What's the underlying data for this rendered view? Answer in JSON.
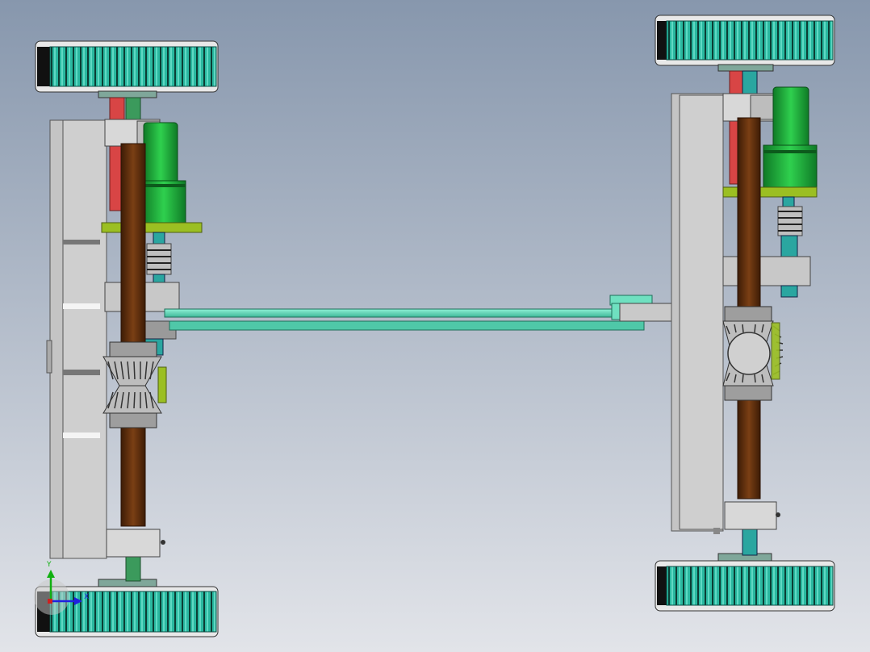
{
  "colors": {
    "background_top": "#8797ad",
    "background_bottom": "#e2e4e9",
    "wheel": "#2ab8a0",
    "wheel_light": "#6fe0cc",
    "wheel_dark": "#0a5a4e",
    "axle": "#5a2d0e",
    "frame_plate": "#c2c2c2",
    "motor": "#1fa83a",
    "bracket": "#9bbf22",
    "red_shaft": "#d84040",
    "teal_shaft": "#2aa6a0",
    "green_shaft": "#2e8a50",
    "rod": "#6fe0c0",
    "gear": "#8a8a8a",
    "axis_x": "#2020e0",
    "axis_y": "#10b010"
  },
  "triad": {
    "x_label": "X",
    "y_label": "Y"
  }
}
